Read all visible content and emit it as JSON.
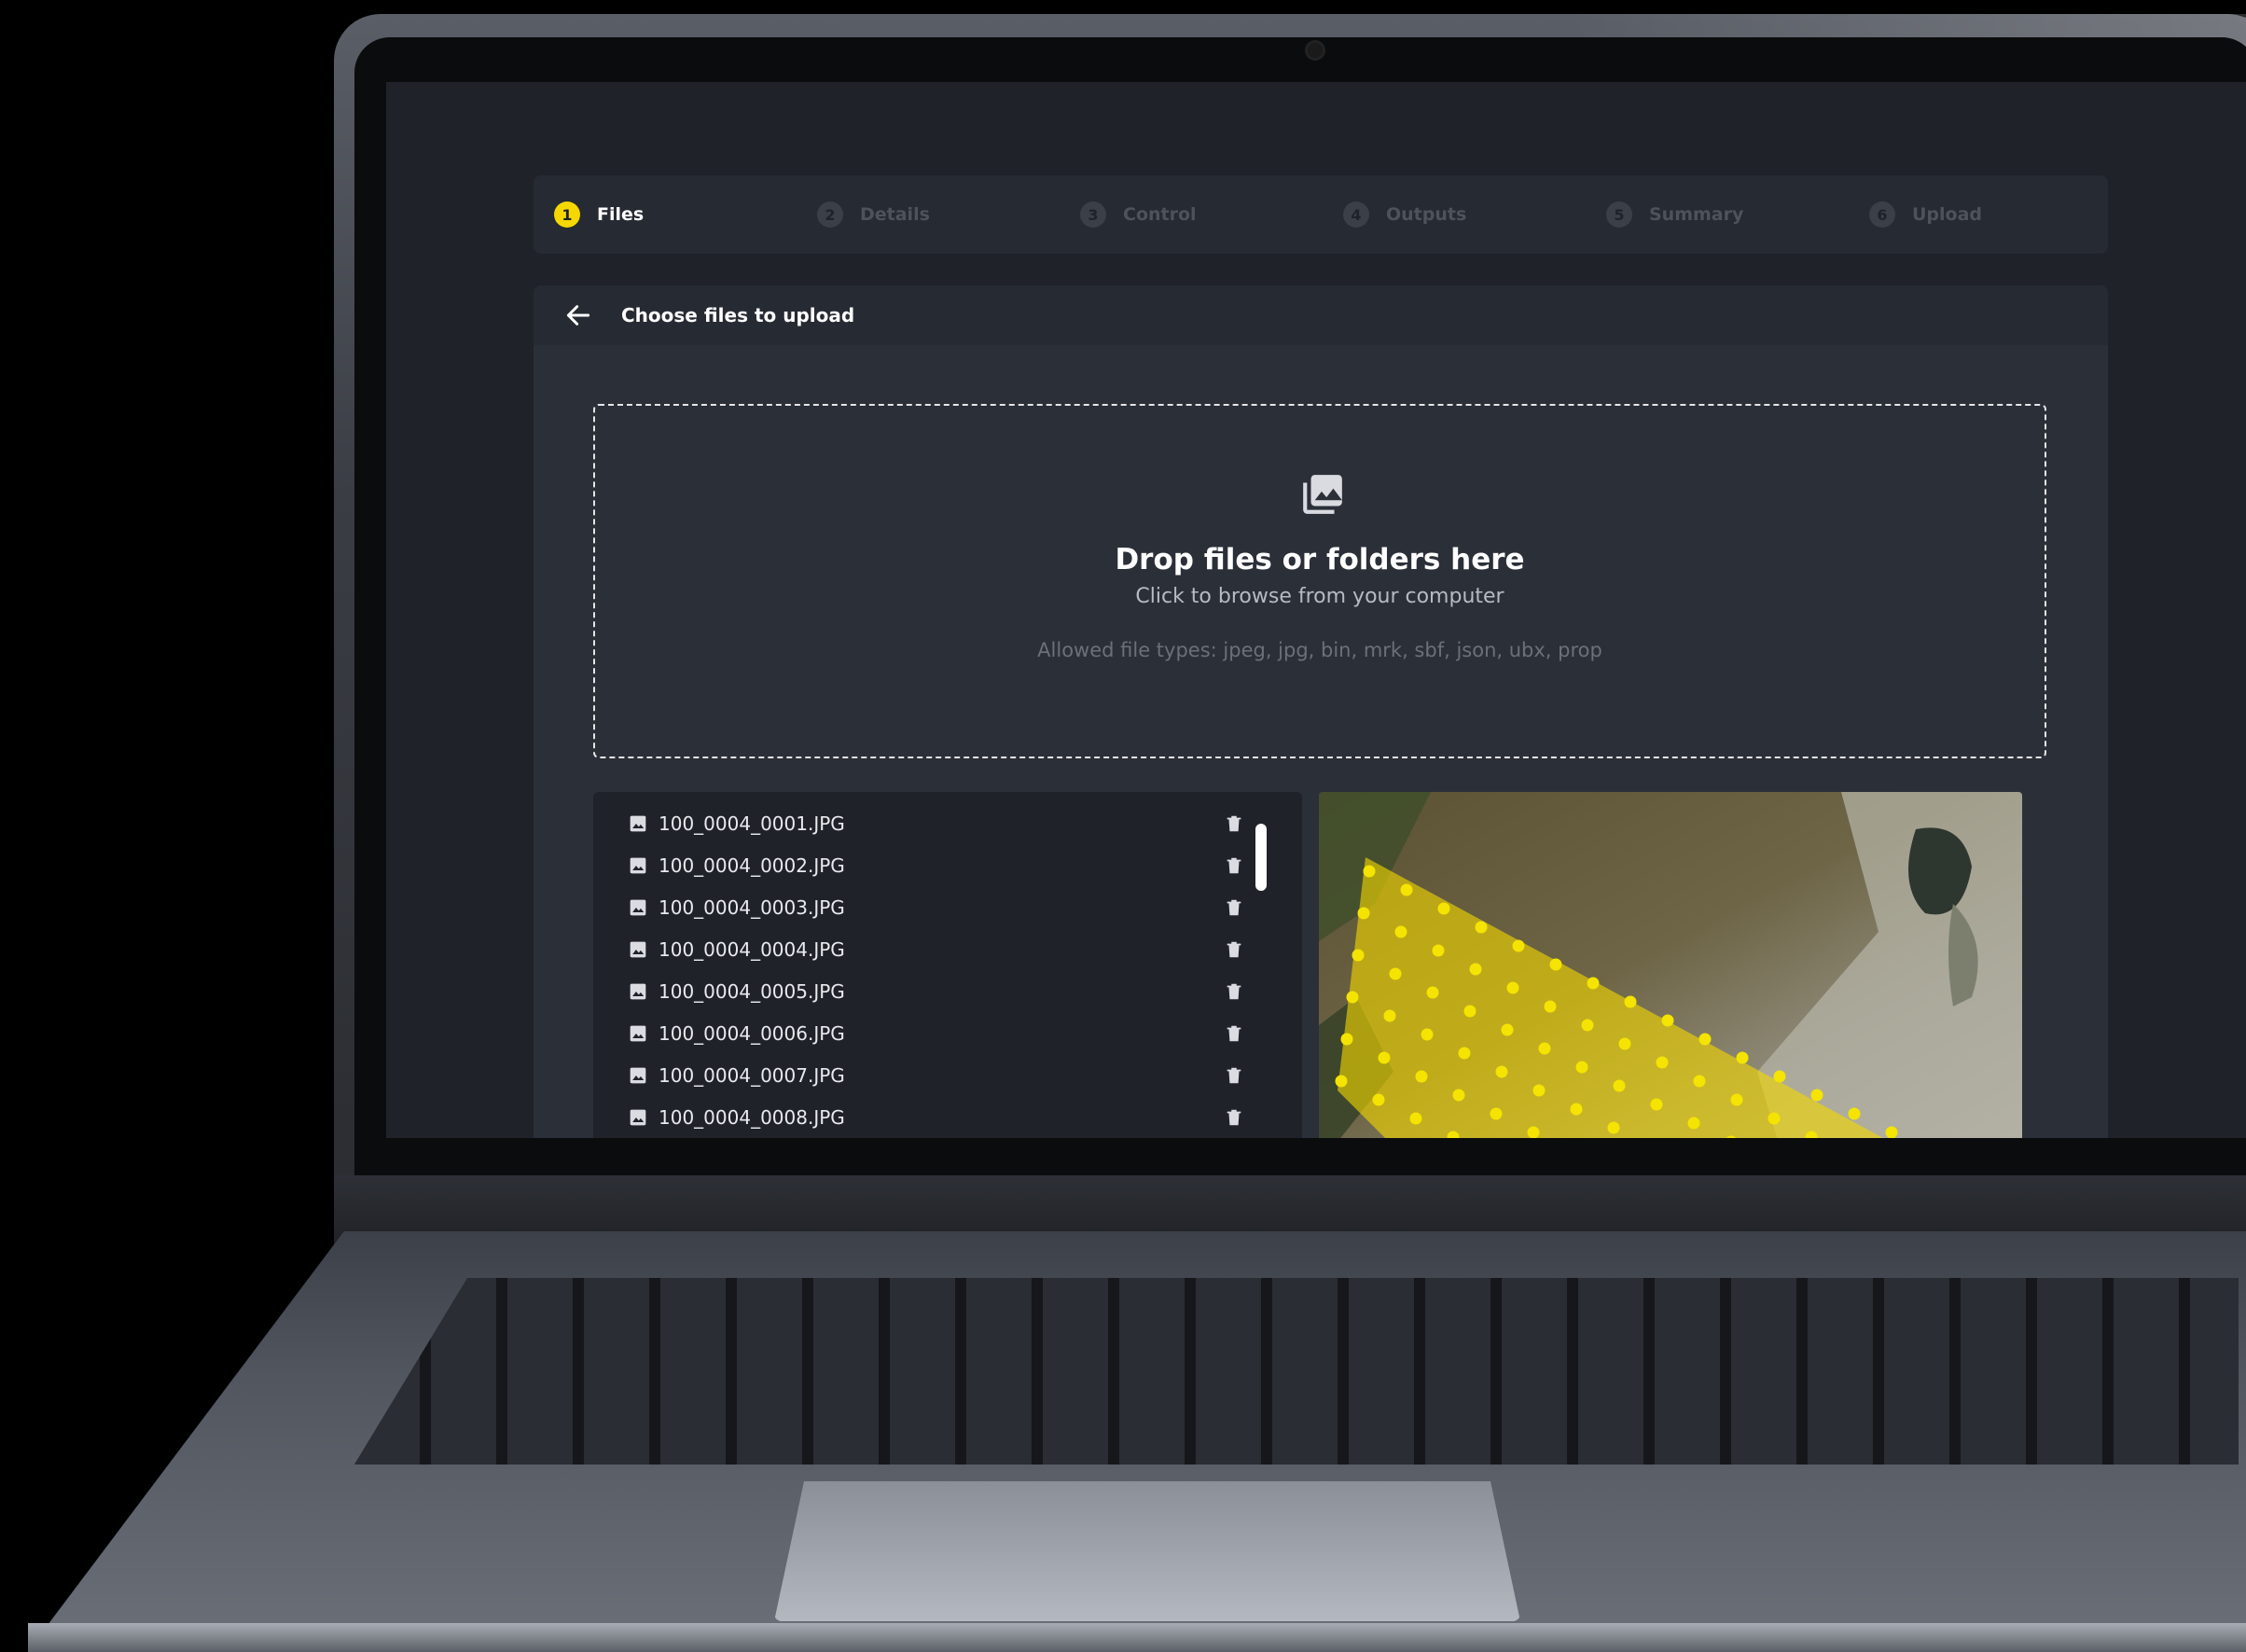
{
  "stepper": {
    "steps": [
      {
        "num": "1",
        "label": "Files"
      },
      {
        "num": "2",
        "label": "Details"
      },
      {
        "num": "3",
        "label": "Control"
      },
      {
        "num": "4",
        "label": "Outputs"
      },
      {
        "num": "5",
        "label": "Summary"
      },
      {
        "num": "6",
        "label": "Upload"
      }
    ],
    "active_index": 0
  },
  "header": {
    "title": "Choose files to upload",
    "back_icon": "arrow-left-icon"
  },
  "dropzone": {
    "icon": "image-stack-icon",
    "title": "Drop files or folders here",
    "subtitle": "Click to browse from your computer",
    "allowed": "Allowed file types: jpeg, jpg, bin, mrk, sbf, json, ubx, prop"
  },
  "files": [
    "100_0004_0001.JPG",
    "100_0004_0002.JPG",
    "100_0004_0003.JPG",
    "100_0004_0004.JPG",
    "100_0004_0005.JPG",
    "100_0004_0006.JPG",
    "100_0004_0007.JPG",
    "100_0004_0008.JPG"
  ],
  "icons": {
    "file": "image-file-icon",
    "delete": "trash-icon"
  },
  "colors": {
    "accent": "#f5d800",
    "screen_bg": "#1f2229",
    "card_bg": "#2b2f38"
  }
}
